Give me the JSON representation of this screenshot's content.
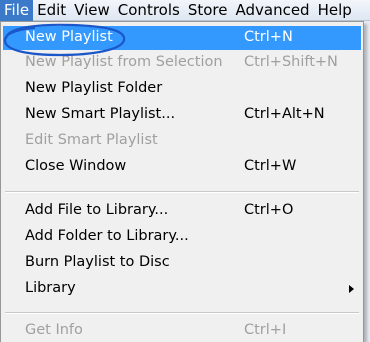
{
  "menubar": {
    "items": [
      {
        "label": "File",
        "active": true
      },
      {
        "label": "Edit"
      },
      {
        "label": "View"
      },
      {
        "label": "Controls"
      },
      {
        "label": "Store"
      },
      {
        "label": "Advanced"
      },
      {
        "label": "Help"
      }
    ]
  },
  "file_menu": {
    "items": [
      {
        "label": "New Playlist",
        "shortcut": "Ctrl+N",
        "enabled": true,
        "highlighted": true
      },
      {
        "label": "New Playlist from Selection",
        "shortcut": "Ctrl+Shift+N",
        "enabled": false
      },
      {
        "label": "New Playlist Folder",
        "shortcut": "",
        "enabled": true
      },
      {
        "label": "New Smart Playlist...",
        "shortcut": "Ctrl+Alt+N",
        "enabled": true
      },
      {
        "label": "Edit Smart Playlist",
        "shortcut": "",
        "enabled": false
      },
      {
        "label": "Close Window",
        "shortcut": "Ctrl+W",
        "enabled": true
      },
      {
        "label": "Add File to Library...",
        "shortcut": "Ctrl+O",
        "enabled": true
      },
      {
        "label": "Add Folder to Library...",
        "shortcut": "",
        "enabled": true
      },
      {
        "label": "Burn Playlist to Disc",
        "shortcut": "",
        "enabled": true
      },
      {
        "label": "Library",
        "shortcut": "",
        "enabled": true,
        "submenu": true
      },
      {
        "label": "Get Info",
        "shortcut": "Ctrl+I",
        "enabled": false
      }
    ]
  },
  "colors": {
    "highlight": "#3399ff",
    "annotation": "#1c57c9",
    "disabled_text": "#a0a0a0"
  },
  "icons": {
    "submenu": "chevron-right-icon"
  }
}
